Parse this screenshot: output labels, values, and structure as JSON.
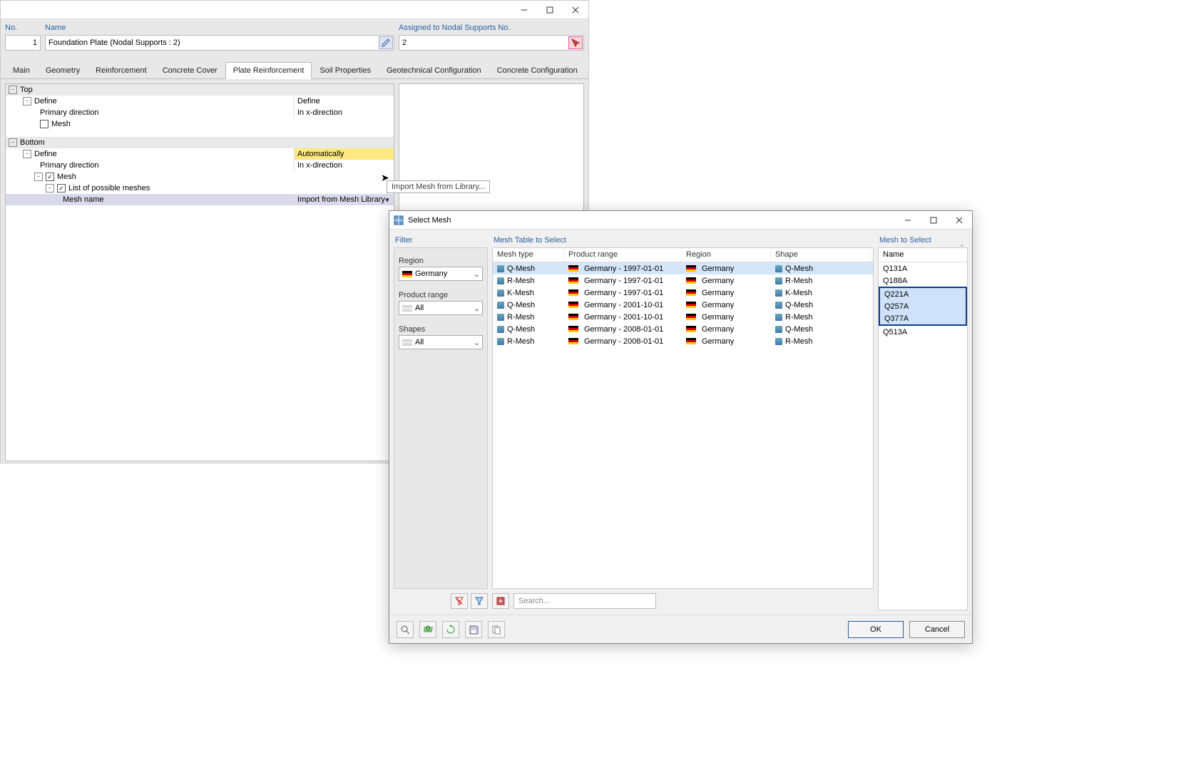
{
  "main": {
    "header": {
      "no_label": "No.",
      "no_value": "1",
      "name_label": "Name",
      "name_value": "Foundation Plate (Nodal Supports : 2)",
      "assign_label": "Assigned to Nodal Supports No.",
      "assign_value": "2"
    },
    "tabs": [
      "Main",
      "Geometry",
      "Reinforcement",
      "Concrete Cover",
      "Plate Reinforcement",
      "Soil Properties",
      "Geotechnical Configuration",
      "Concrete Configuration"
    ],
    "active_tab": 4,
    "tree": {
      "top": {
        "section": "Top",
        "define": "Define",
        "define_val": "Define",
        "primary": "Primary direction",
        "primary_val": "In x-direction",
        "mesh": "Mesh"
      },
      "bottom": {
        "section": "Bottom",
        "define": "Define",
        "define_val": "Automatically",
        "primary": "Primary direction",
        "primary_val": "In x-direction",
        "mesh": "Mesh",
        "list": "List of possible meshes",
        "meshname": "Mesh name",
        "meshname_val": "Import from Mesh Library"
      }
    },
    "tooltip": "Import Mesh from Library..."
  },
  "dialog": {
    "title": "Select Mesh",
    "filter": {
      "head": "Filter",
      "region_lbl": "Region",
      "region_val": "Germany",
      "prod_lbl": "Product range",
      "prod_val": "All",
      "shapes_lbl": "Shapes",
      "shapes_val": "All"
    },
    "table": {
      "head": "Mesh Table to Select",
      "cols": [
        "Mesh type",
        "Product range",
        "Region",
        "Shape"
      ],
      "rows": [
        {
          "type": "Q-Mesh",
          "range": "Germany - 1997-01-01",
          "region": "Germany",
          "shape": "Q-Mesh",
          "sel": true
        },
        {
          "type": "R-Mesh",
          "range": "Germany - 1997-01-01",
          "region": "Germany",
          "shape": "R-Mesh",
          "sel": false
        },
        {
          "type": "K-Mesh",
          "range": "Germany - 1997-01-01",
          "region": "Germany",
          "shape": "K-Mesh",
          "sel": false
        },
        {
          "type": "Q-Mesh",
          "range": "Germany - 2001-10-01",
          "region": "Germany",
          "shape": "Q-Mesh",
          "sel": false
        },
        {
          "type": "R-Mesh",
          "range": "Germany - 2001-10-01",
          "region": "Germany",
          "shape": "R-Mesh",
          "sel": false
        },
        {
          "type": "Q-Mesh",
          "range": "Germany - 2008-01-01",
          "region": "Germany",
          "shape": "Q-Mesh",
          "sel": false
        },
        {
          "type": "R-Mesh",
          "range": "Germany - 2008-01-01",
          "region": "Germany",
          "shape": "R-Mesh",
          "sel": false
        }
      ],
      "search_ph": "Search..."
    },
    "select": {
      "head": "Mesh to Select",
      "col": "Name",
      "rows": [
        "Q131A",
        "Q188A",
        "Q221A",
        "Q257A",
        "Q377A",
        "Q513A"
      ],
      "group_start": 2,
      "group_end": 4
    },
    "buttons": {
      "ok": "OK",
      "cancel": "Cancel"
    }
  }
}
